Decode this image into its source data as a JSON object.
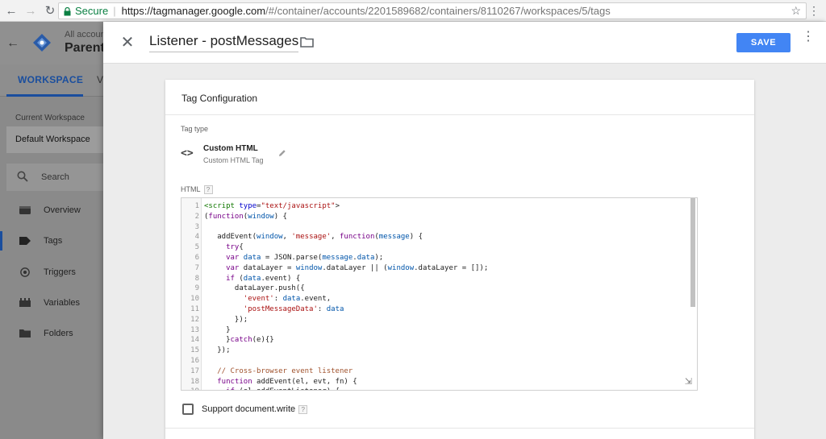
{
  "browser": {
    "secure_label": "Secure",
    "url_host": "https://tagmanager.google.com",
    "url_path": "/#/container/accounts/2201589682/containers/8110267/workspaces/5/tags"
  },
  "gtm": {
    "account_label": "All accounts",
    "account_name": "Parent",
    "tabs": [
      "WORKSPACE",
      "V"
    ],
    "current_workspace_label": "Current Workspace",
    "workspace_name": "Default Workspace",
    "search_placeholder": "Search",
    "menu": [
      "Overview",
      "Tags",
      "Triggers",
      "Variables",
      "Folders"
    ],
    "active_menu": "Tags"
  },
  "panel": {
    "tag_name": "Listener - postMessages",
    "save_label": "SAVE",
    "card_title": "Tag Configuration",
    "tag_type_label": "Tag type",
    "tag_type_name": "Custom HTML",
    "tag_type_sub": "Custom HTML Tag",
    "html_label": "HTML",
    "help_mark": "?",
    "support_label": "Support document.write"
  },
  "code_lines": [
    {
      "n": "1",
      "t": "<script type=\"text/javascript\">"
    },
    {
      "n": "2",
      "t": "(function(window) {"
    },
    {
      "n": "3",
      "t": ""
    },
    {
      "n": "4",
      "t": "   addEvent(window, 'message', function(message) {"
    },
    {
      "n": "5",
      "t": "     try{"
    },
    {
      "n": "6",
      "t": "     var data = JSON.parse(message.data);"
    },
    {
      "n": "7",
      "t": "     var dataLayer = window.dataLayer || (window.dataLayer = []);"
    },
    {
      "n": "8",
      "t": "     if (data.event) {"
    },
    {
      "n": "9",
      "t": "       dataLayer.push({"
    },
    {
      "n": "10",
      "t": "         'event': data.event,"
    },
    {
      "n": "11",
      "t": "         'postMessageData': data"
    },
    {
      "n": "12",
      "t": "       });"
    },
    {
      "n": "13",
      "t": "     }"
    },
    {
      "n": "14",
      "t": "     }catch(e){}"
    },
    {
      "n": "15",
      "t": "   });"
    },
    {
      "n": "16",
      "t": ""
    },
    {
      "n": "17",
      "t": "   // Cross-browser event listener"
    },
    {
      "n": "18",
      "t": "   function addEvent(el, evt, fn) {"
    },
    {
      "n": "19",
      "t": "     if (el.addEventListener) {"
    }
  ]
}
